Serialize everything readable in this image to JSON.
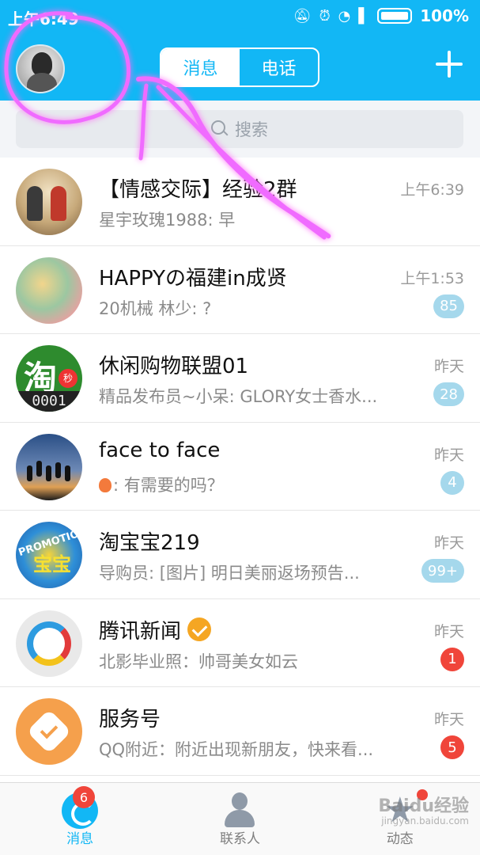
{
  "status_bar": {
    "time": "上午6:49",
    "battery_percent": "100%",
    "icons": [
      "mute-icon",
      "alarm-icon",
      "wifi-icon",
      "signal-icon",
      "battery-icon"
    ]
  },
  "header": {
    "tabs": [
      {
        "label": "消息",
        "active": true
      },
      {
        "label": "电话",
        "active": false
      }
    ],
    "add_icon": "plus-icon"
  },
  "search": {
    "placeholder": "搜索"
  },
  "conversations": [
    {
      "name": "【情感交际】经验2群",
      "preview": "星宇玫瑰1988: 早",
      "time": "上午6:39",
      "badge": null
    },
    {
      "name": "HAPPYの福建in成贤",
      "preview": "20机械  林少: ?",
      "time": "上午1:53",
      "badge": "85",
      "badge_style": "muted"
    },
    {
      "name": "休闲购物联盟01",
      "preview": "精品发布员~小呆: GLORY女士香水...",
      "time": "昨天",
      "badge": "28",
      "badge_style": "muted",
      "avatar_text": "淘",
      "avatar_digits": "0001",
      "avatar_miao": "秒"
    },
    {
      "name": "face to face",
      "preview": ": 有需要的吗？",
      "time": "昨天",
      "badge": "4",
      "badge_style": "muted"
    },
    {
      "name": "淘宝宝219",
      "preview": "导购员: [图片] 明日美丽返场预告...",
      "time": "昨天",
      "badge": "99+",
      "badge_style": "muted",
      "avatar_text": "PROMOTION",
      "avatar_bao": "宝宝"
    },
    {
      "name": "腾讯新闻",
      "preview": "北影毕业照：帅哥美女如云",
      "time": "昨天",
      "badge": "1",
      "badge_style": "alert",
      "verified": true
    },
    {
      "name": "服务号",
      "preview": "QQ附近：附近出现新朋友，快来看...",
      "time": "昨天",
      "badge": "5",
      "badge_style": "alert"
    }
  ],
  "bottom_nav": [
    {
      "label": "消息",
      "icon": "message-icon",
      "badge": "6",
      "active": true
    },
    {
      "label": "联系人",
      "icon": "contacts-icon",
      "active": false
    },
    {
      "label": "动态",
      "icon": "star-icon",
      "dot": true,
      "active": false
    }
  ],
  "watermark": {
    "text": "Baidu经验",
    "sub": "jingyan.baidu.com"
  },
  "colors": {
    "accent": "#12b7f5",
    "badge_alert": "#f0453a",
    "badge_muted": "#a5d8ec",
    "doodle": "#e040ff"
  }
}
